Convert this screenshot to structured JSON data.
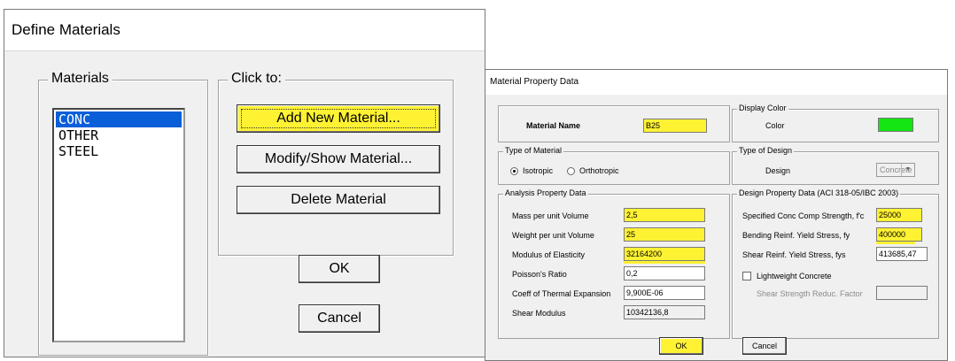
{
  "dlg1": {
    "title": "Define Materials",
    "materials_label": "Materials",
    "materials": [
      "CONC",
      "OTHER",
      "STEEL"
    ],
    "selected_index": 0,
    "click_label": "Click to:",
    "add_btn": "Add New Material...",
    "modify_btn": "Modify/Show Material...",
    "delete_btn": "Delete Material",
    "ok_btn": "OK",
    "cancel_btn": "Cancel"
  },
  "dlg2": {
    "title": "Material Property Data",
    "material_name_label": "Material Name",
    "material_name": "B25",
    "display_color_group": "Display Color",
    "color_label": "Color",
    "color_value": "#13e613",
    "type_material_group": "Type of Material",
    "isotropic": "Isotropic",
    "orthotropic": "Orthotropic",
    "type_design_group": "Type of Design",
    "design_label": "Design",
    "design_value": "Concrete",
    "analysis_group": "Analysis Property Data",
    "mass_label": "Mass per unit Volume",
    "mass_value": "2,5",
    "weight_label": "Weight per unit Volume",
    "weight_value": "25",
    "modulus_label": "Modulus of Elasticity",
    "modulus_value": "32164200",
    "poisson_label": "Poisson's Ratio",
    "poisson_value": "0,2",
    "thermal_label": "Coeff of Thermal Expansion",
    "thermal_value": "9,900E-06",
    "shear_mod_label": "Shear Modulus",
    "shear_mod_value": "10342136,8",
    "design_group": "Design Property Data (ACI 318-05/IBC 2003)",
    "fc_label": "Specified Conc Comp Strength, f'c",
    "fc_value": "25000",
    "fy_label": "Bending Reinf. Yield Stress, fy",
    "fy_value": "400000",
    "fys_label": "Shear Reinf. Yield Stress, fys",
    "fys_value": "413685,47",
    "lightweight_label": "Lightweight Concrete",
    "shear_reduc_label": "Shear Strength Reduc. Factor",
    "ok_btn": "OK",
    "cancel_btn": "Cancel"
  },
  "colors": {
    "highlight": "#fff233",
    "selection": "#0a5fd8",
    "dialog_bg": "#f0f0f0"
  }
}
